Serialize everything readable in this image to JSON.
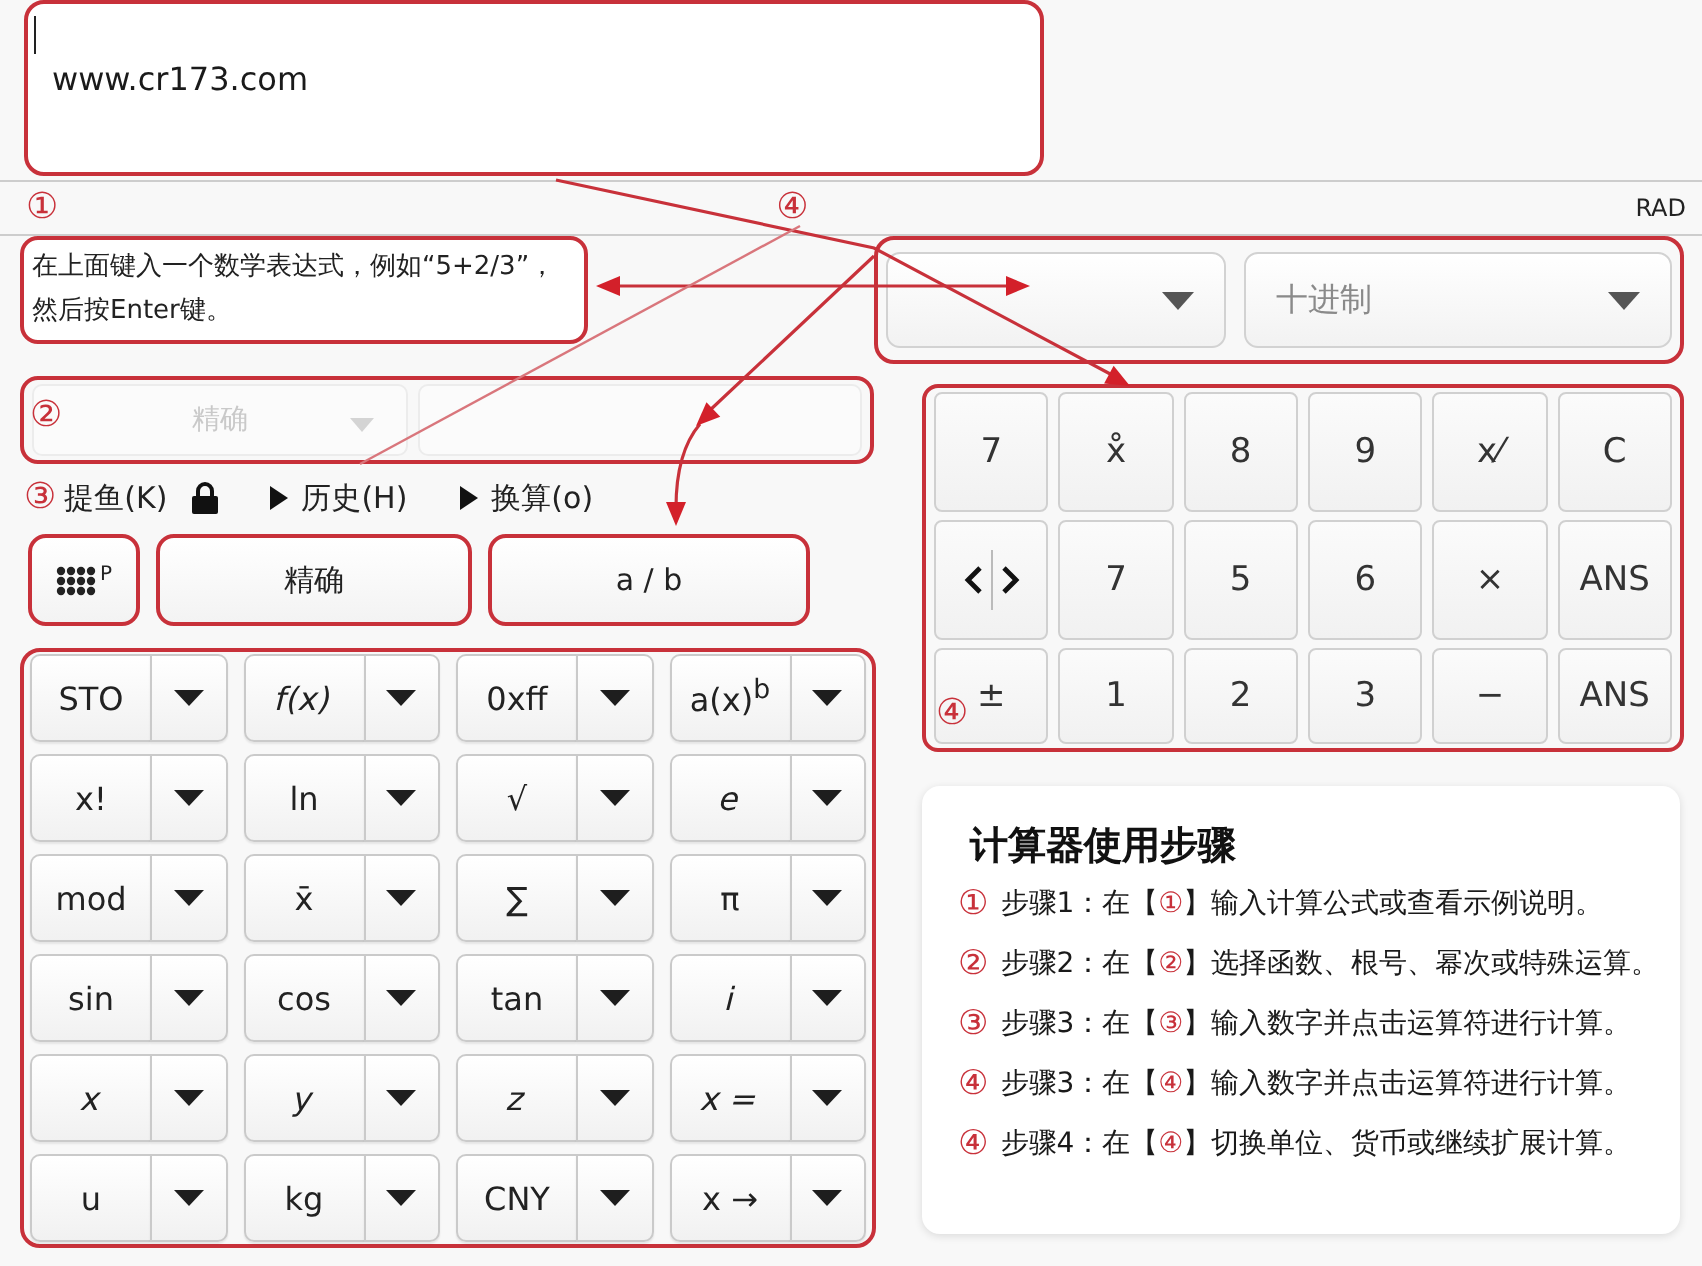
{
  "input": {
    "value": "www.cr173.com"
  },
  "status_bar": {
    "markers": [
      "①",
      "④"
    ],
    "angle_unit": "RAD"
  },
  "hint": {
    "lines": [
      "在上面键入一个数学表达式，例如“5+2/3”，",
      "然后按Enter键。"
    ]
  },
  "options_row": {
    "marker": "②",
    "dropdown": {
      "label": "精确"
    }
  },
  "toolbar": {
    "marker": "③",
    "items": [
      {
        "kind": "menu",
        "label": "提鱼(K)"
      },
      {
        "kind": "lock"
      },
      {
        "kind": "expander",
        "label": "历史(H)",
        "expanded": false
      },
      {
        "kind": "expander",
        "label": "换算(o)",
        "expanded": false
      }
    ]
  },
  "mode_buttons": [
    {
      "kind": "keypad",
      "label": "P"
    },
    {
      "kind": "text",
      "label": "精确"
    },
    {
      "kind": "text",
      "label": "a / b"
    }
  ],
  "function_keys": [
    [
      {
        "label": "STO",
        "italic": false
      },
      {
        "label": "f(x)",
        "italic": true
      },
      {
        "label": "0xff",
        "italic": false
      },
      {
        "label": "a(x)$^{b}$",
        "italic": false
      }
    ],
    [
      {
        "label": "x!",
        "italic": false
      },
      {
        "label": "ln",
        "italic": false
      },
      {
        "label": "√",
        "italic": false
      },
      {
        "label": "e",
        "italic": true
      }
    ],
    [
      {
        "label": "mod",
        "italic": false
      },
      {
        "label": "x̄",
        "italic": false
      },
      {
        "label": "∑",
        "italic": false
      },
      {
        "label": "π",
        "italic": false
      }
    ],
    [
      {
        "label": "sin",
        "italic": false
      },
      {
        "label": "cos",
        "italic": false
      },
      {
        "label": "tan",
        "italic": false
      },
      {
        "label": "i",
        "italic": true
      }
    ],
    [
      {
        "label": "x",
        "italic": true
      },
      {
        "label": "y",
        "italic": true
      },
      {
        "label": "z",
        "italic": true
      },
      {
        "label": "x =",
        "italic": true
      }
    ],
    [
      {
        "label": "u",
        "italic": false
      },
      {
        "label": "kg",
        "italic": false
      },
      {
        "label": "CNY",
        "italic": false
      },
      {
        "label": "x →",
        "italic": false
      }
    ]
  ],
  "dropdowns": [
    {
      "kind": "blank"
    },
    {
      "kind": "text",
      "label": "十进制"
    }
  ],
  "keypad": {
    "marker": "④",
    "rows": [
      [
        {
          "kind": "text",
          "label": "7"
        },
        {
          "kind": "text",
          "label": "x̊"
        },
        {
          "kind": "text",
          "label": "8"
        },
        {
          "kind": "text",
          "label": "9"
        },
        {
          "kind": "text",
          "label": "x⁄"
        },
        {
          "kind": "text",
          "label": "C"
        }
      ],
      [
        {
          "kind": "cursor"
        },
        {
          "kind": "text",
          "label": "7"
        },
        {
          "kind": "text",
          "label": "5"
        },
        {
          "kind": "text",
          "label": "6"
        },
        {
          "kind": "text",
          "label": "×"
        },
        {
          "kind": "text",
          "label": "ANS"
        }
      ],
      [
        {
          "kind": "text",
          "label": "±"
        },
        {
          "kind": "text",
          "label": "1"
        },
        {
          "kind": "text",
          "label": "2"
        },
        {
          "kind": "text",
          "label": "3"
        },
        {
          "kind": "text",
          "label": "−"
        },
        {
          "kind": "text",
          "label": "ANS"
        }
      ]
    ]
  },
  "instructions": {
    "title": "计算器使用步骤",
    "steps": [
      {
        "marker": "①",
        "before": "步骤1：在【",
        "ref": "①",
        "after": "】输入计算公式或查看示例说明。"
      },
      {
        "marker": "②",
        "before": "步骤2：在【",
        "ref": "②",
        "after": "】选择函数、根号、幂次或特殊运算。"
      },
      {
        "marker": "③",
        "before": "步骤3：在【",
        "ref": "③",
        "after": "】输入数字并点击运算符进行计算。"
      },
      {
        "marker": "④",
        "before": "步骤3：在【",
        "ref": "④",
        "after": "】输入数字并点击运算符进行计算。"
      },
      {
        "marker": "④",
        "before": "步骤4：在【",
        "ref": "④",
        "after": "】切换单位、货币或继续扩展计算。"
      }
    ]
  }
}
